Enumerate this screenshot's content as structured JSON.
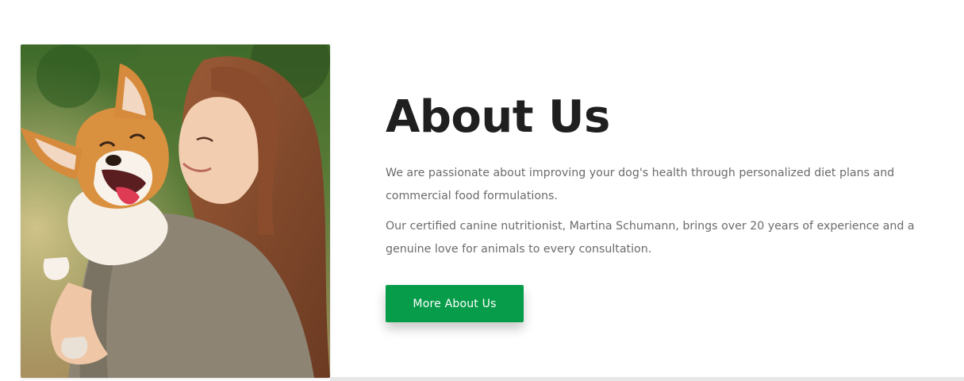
{
  "about": {
    "title": "About Us",
    "paragraph_1": "We are passionate about improving your dog's health through personalized diet plans and commercial food formulations.",
    "paragraph_2": "Our certified canine nutritionist, Martina Schumann, brings over 20 years of experience and a genuine love for animals to every consultation.",
    "button_label": "More About Us"
  },
  "colors": {
    "accent": "#079c49",
    "heading": "#1f1f1f",
    "body_text": "#6b6b6b"
  },
  "image": {
    "semantic": "woman-hugging-corgi-photo"
  }
}
